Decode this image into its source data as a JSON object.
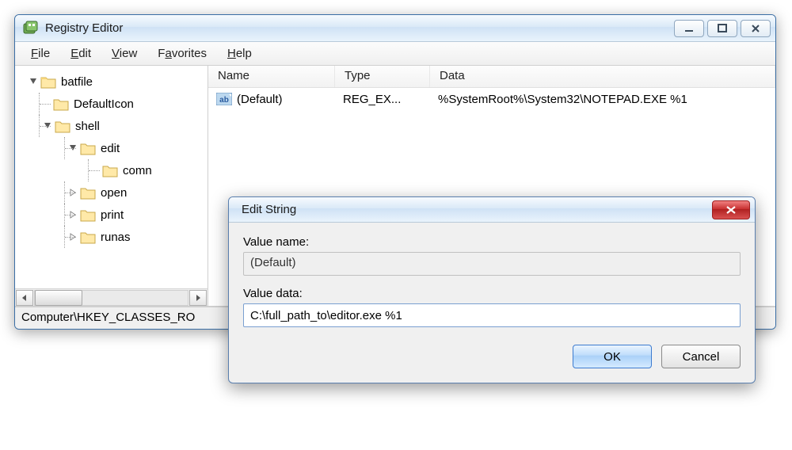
{
  "window": {
    "title": "Registry Editor",
    "menus": {
      "file": "File",
      "edit": "Edit",
      "view": "View",
      "favorites": "Favorites",
      "help": "Help"
    }
  },
  "tree": {
    "batfile": "batfile",
    "defaulticon": "DefaultIcon",
    "shell": "shell",
    "edit": "edit",
    "command": "comn",
    "open": "open",
    "print": "print",
    "runas": "runas"
  },
  "list": {
    "columns": {
      "name": "Name",
      "type": "Type",
      "data": "Data"
    },
    "rows": [
      {
        "name": "(Default)",
        "type": "REG_EX...",
        "data": "%SystemRoot%\\System32\\NOTEPAD.EXE %1"
      }
    ]
  },
  "statusbar": "Computer\\HKEY_CLASSES_RO",
  "dialog": {
    "title": "Edit String",
    "value_name_label": "Value name:",
    "value_name": "(Default)",
    "value_data_label": "Value data:",
    "value_data": "C:\\full_path_to\\editor.exe %1",
    "ok": "OK",
    "cancel": "Cancel"
  }
}
